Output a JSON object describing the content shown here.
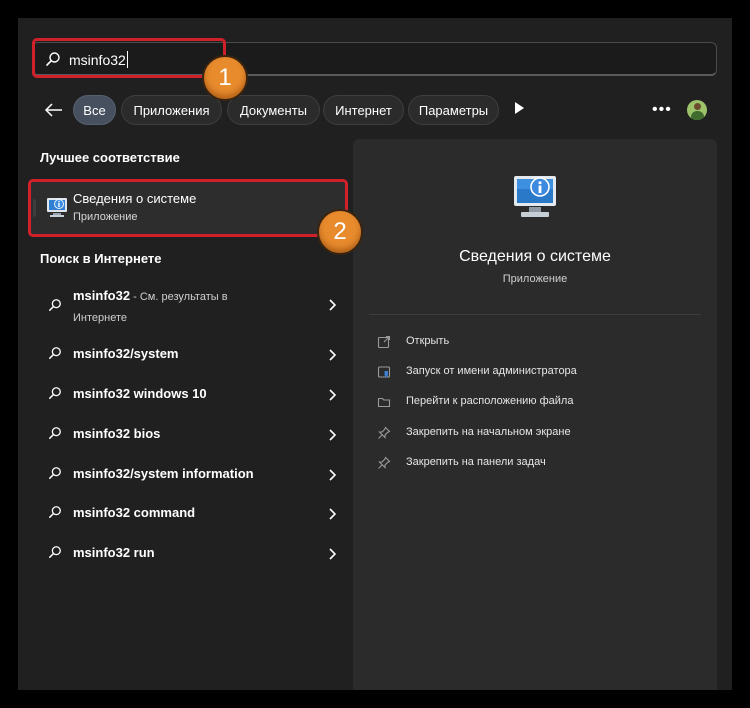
{
  "search": {
    "query": "msinfo32",
    "icon": "search-icon"
  },
  "filters": {
    "back_icon": "arrow-left-icon",
    "chips": [
      "Все",
      "Приложения",
      "Документы",
      "Интернет",
      "Параметры"
    ],
    "active_index": 0,
    "more_label": "•••",
    "play_icon": "play-icon",
    "avatar_icon": "user-avatar"
  },
  "best_match": {
    "heading": "Лучшее соответствие",
    "title": "Сведения о системе",
    "subtitle": "Приложение",
    "icon": "system-info-icon"
  },
  "web": {
    "heading": "Поиск в Интернете",
    "first": {
      "bold": "msinfo32",
      "rest": " - См. результаты в Интернете"
    },
    "items": [
      "msinfo32/system",
      "msinfo32 windows 10",
      "msinfo32 bios",
      "msinfo32/system information",
      "msinfo32 command",
      "msinfo32 run"
    ]
  },
  "detail": {
    "title": "Сведения о системе",
    "subtitle": "Приложение",
    "actions": [
      {
        "label": "Открыть",
        "icon": "open-icon"
      },
      {
        "label": "Запуск от имени администратора",
        "icon": "admin-shield-icon"
      },
      {
        "label": "Перейти к расположению файла",
        "icon": "folder-icon"
      },
      {
        "label": "Закрепить на начальном экране",
        "icon": "pin-icon"
      },
      {
        "label": "Закрепить на панели задач",
        "icon": "pin-icon"
      }
    ]
  },
  "callouts": {
    "one": "1",
    "two": "2",
    "color": "#d0202a",
    "badge_color": "#e88b2d"
  }
}
